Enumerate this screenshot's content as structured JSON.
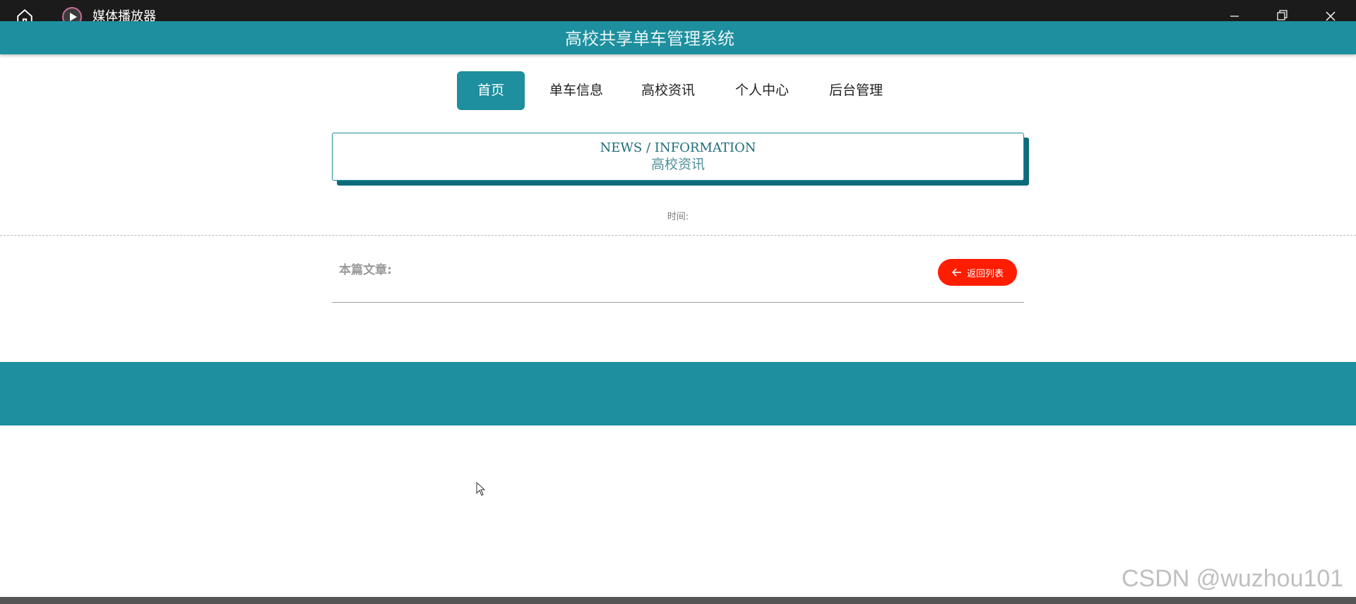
{
  "window": {
    "app_title": "媒体播放器"
  },
  "site": {
    "title": "高校共享单车管理系统"
  },
  "nav": {
    "items": [
      {
        "label": "首页",
        "active": true
      },
      {
        "label": "单车信息"
      },
      {
        "label": "高校资讯"
      },
      {
        "label": "个人中心"
      },
      {
        "label": "后台管理"
      }
    ]
  },
  "news": {
    "title_en": "NEWS / INFORMATION",
    "title_cn": "高校资讯",
    "time_label": "时间:"
  },
  "article": {
    "label": "本篇文章:",
    "back_label": "返回列表"
  },
  "watermark": "CSDN @wuzhou101",
  "colors": {
    "accent": "#1d8f9e",
    "back_button": "#ff1d00",
    "titlebar": "#1b1b1b"
  }
}
